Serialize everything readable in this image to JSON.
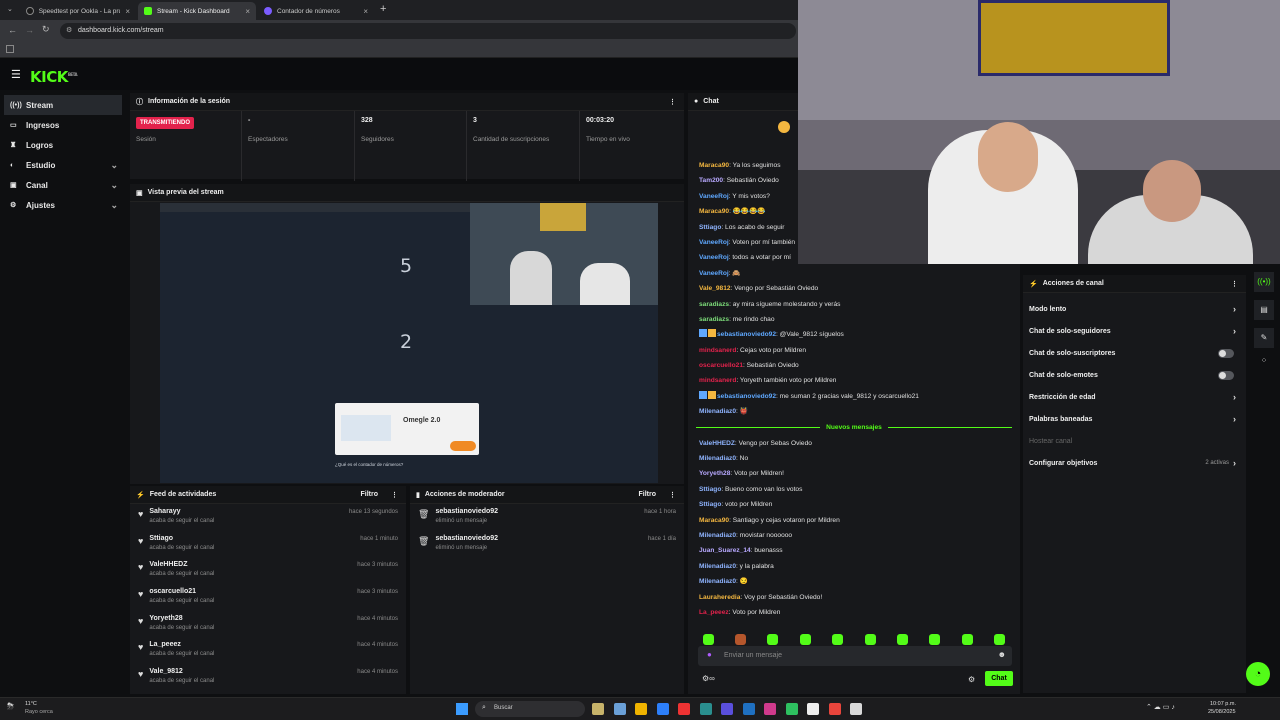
{
  "browser": {
    "tabs": [
      {
        "title": "Speedtest por Ookla - La prueba de velocidad",
        "active": false
      },
      {
        "title": "Stream - Kick Dashboard",
        "active": true
      },
      {
        "title": "Contador de números",
        "active": false
      }
    ],
    "url": "dashboard.kick.com/stream"
  },
  "kick": {
    "logo": "KICK",
    "beta": "BETA"
  },
  "sidebar": {
    "items": [
      {
        "label": "Stream",
        "icon": "stream-icon",
        "selected": true,
        "expand": false
      },
      {
        "label": "Ingresos",
        "icon": "wallet-icon",
        "selected": false,
        "expand": false
      },
      {
        "label": "Logros",
        "icon": "trophy-icon",
        "selected": false,
        "expand": false
      },
      {
        "label": "Estudio",
        "icon": "studio-icon",
        "selected": false,
        "expand": true
      },
      {
        "label": "Canal",
        "icon": "channel-icon",
        "selected": false,
        "expand": true
      },
      {
        "label": "Ajustes",
        "icon": "gear-icon",
        "selected": false,
        "expand": true
      }
    ]
  },
  "session": {
    "title": "Información de la sesión",
    "badge": "TRANSMITIENDO",
    "stats": [
      {
        "value": "",
        "label": "Sesión"
      },
      {
        "value": "-",
        "label": "Espectadores"
      },
      {
        "value": "328",
        "label": "Seguidores"
      },
      {
        "value": "3",
        "label": "Cantidad de suscripciones"
      },
      {
        "value": "00:03:20",
        "label": "Tiempo en vivo"
      }
    ]
  },
  "preview": {
    "title": "Vista previa del stream",
    "numbers": [
      "5",
      "2"
    ],
    "omegle": "Omegle 2.0",
    "question": "¿Qué es el contador de números?"
  },
  "feed": {
    "title": "Feed de actividades",
    "filter": "Filtro",
    "items": [
      {
        "name": "Saharayy",
        "action": "acaba de seguir el canal",
        "time": "hace 13 segundos"
      },
      {
        "name": "Sttiago",
        "action": "acaba de seguir el canal",
        "time": "hace 1 minuto"
      },
      {
        "name": "ValeHHEDZ",
        "action": "acaba de seguir el canal",
        "time": "hace 3 minutos"
      },
      {
        "name": "oscarcuello21",
        "action": "acaba de seguir el canal",
        "time": "hace 3 minutos"
      },
      {
        "name": "Yoryeth28",
        "action": "acaba de seguir el canal",
        "time": "hace 4 minutos"
      },
      {
        "name": "La_peeez",
        "action": "acaba de seguir el canal",
        "time": "hace 4 minutos"
      },
      {
        "name": "Vale_9812",
        "action": "acaba de seguir el canal",
        "time": "hace 4 minutos"
      }
    ]
  },
  "mod": {
    "title": "Acciones de moderador",
    "filter": "Filtro",
    "items": [
      {
        "name": "sebastianoviedo92",
        "action": "eliminó un mensaje",
        "time": "hace 1 hora"
      },
      {
        "name": "sebastianoviedo92",
        "action": "eliminó un mensaje",
        "time": "hace 1 día"
      }
    ]
  },
  "chat": {
    "title": "Chat",
    "divider": "Nuevos mensajes",
    "placeholder": "Enviar un mensaje",
    "send": "Chat",
    "messages": [
      {
        "user": "Maraca90",
        "color": "#f4b740",
        "text": ": Ya los seguimos",
        "badges": 0
      },
      {
        "user": "Tam200",
        "color": "#b8a9ff",
        "text": ": Sebastián Oviedo",
        "badges": 0
      },
      {
        "user": "VaneeRoj",
        "color": "#5fa8ff",
        "text": ": Y mis votos?",
        "badges": 0
      },
      {
        "user": "Maraca90",
        "color": "#f4b740",
        "text": ": 😂😂😂😂",
        "badges": 0
      },
      {
        "user": "Sttiago",
        "color": "#8fb4ff",
        "text": ": Los acabo de seguir",
        "badges": 0
      },
      {
        "user": "VaneeRoj",
        "color": "#5fa8ff",
        "text": ": Voten por mí también",
        "badges": 0
      },
      {
        "user": "VaneeRoj",
        "color": "#5fa8ff",
        "text": ": todos a votar por mí",
        "badges": 0
      },
      {
        "user": "VaneeRoj",
        "color": "#5fa8ff",
        "text": ": 🙈",
        "badges": 0
      },
      {
        "user": "Vale_9812",
        "color": "#f4b740",
        "text": ": Vengo por Sebastián Oviedo",
        "badges": 0
      },
      {
        "user": "saradiazs",
        "color": "#7ddc7a",
        "text": ": ay mira sígueme molestando y verás",
        "badges": 0
      },
      {
        "user": "saradiazs",
        "color": "#7ddc7a",
        "text": ": me rindo chao",
        "badges": 0
      },
      {
        "user": "sebastianoviedo92",
        "color": "#5fa8ff",
        "text": ": @Vale_9812 síguelos",
        "badges": 2
      },
      {
        "user": "mindsanerd",
        "color": "#e3224c",
        "text": ": Cejas voto por Mildren",
        "badges": 0
      },
      {
        "user": "oscarcuello21",
        "color": "#e3224c",
        "text": ": Sebastián Oviedo",
        "badges": 0
      },
      {
        "user": "mindsanerd",
        "color": "#e3224c",
        "text": ": Yoryeth también voto por Mildren",
        "badges": 0
      },
      {
        "user": "sebastianoviedo92",
        "color": "#5fa8ff",
        "text": ": me suman 2 gracias vale_9812 y oscarcuello21",
        "badges": 2
      },
      {
        "user": "Milenadiaz0",
        "color": "#8fb4ff",
        "text": ": 👹",
        "badges": 0
      }
    ],
    "new_messages": [
      {
        "user": "ValeHHEDZ",
        "color": "#8fb4ff",
        "text": ": Vengo por Sebas Oviedo"
      },
      {
        "user": "Milenadiaz0",
        "color": "#8fb4ff",
        "text": ": No"
      },
      {
        "user": "Yoryeth28",
        "color": "#b8a9ff",
        "text": ": Voto por Mildren!"
      },
      {
        "user": "Sttiago",
        "color": "#8fb4ff",
        "text": ": Bueno como van los votos"
      },
      {
        "user": "Sttiago",
        "color": "#8fb4ff",
        "text": ": voto por Mildren"
      },
      {
        "user": "Maraca90",
        "color": "#f4b740",
        "text": ": Santiago y cejas votaron por Mildren"
      },
      {
        "user": "Milenadiaz0",
        "color": "#8fb4ff",
        "text": ": movistar noooooo"
      },
      {
        "user": "Juan_Suarez_14",
        "color": "#b8a9ff",
        "text": ": buenasss"
      },
      {
        "user": "Milenadiaz0",
        "color": "#8fb4ff",
        "text": ": y la palabra"
      },
      {
        "user": "Milenadiaz0",
        "color": "#8fb4ff",
        "text": ": 😏"
      },
      {
        "user": "Lauraheredia",
        "color": "#f4b740",
        "text": ": Voy por Sebastián Oviedo!"
      },
      {
        "user": "La_peeez",
        "color": "#e3224c",
        "text": ": Voto por Mildren"
      }
    ]
  },
  "channel_actions": {
    "title": "Acciones de canal",
    "items": [
      {
        "label": "Modo lento",
        "control": "chevron"
      },
      {
        "label": "Chat de solo-seguidores",
        "control": "chevron"
      },
      {
        "label": "Chat de solo-suscriptores",
        "control": "toggle"
      },
      {
        "label": "Chat de solo-emotes",
        "control": "toggle"
      },
      {
        "label": "Restricción de edad",
        "control": "chevron"
      },
      {
        "label": "Palabras baneadas",
        "control": "chevron"
      },
      {
        "label": "Hostear canal",
        "control": "none"
      },
      {
        "label": "Configurar objetivos",
        "control": "chevron",
        "extra": "2 activas"
      }
    ]
  },
  "taskbar": {
    "weather_temp": "11°C",
    "weather_text": "Rayo cerca",
    "search": "Buscar",
    "time": "10:07 p.m.",
    "date": "25/08/2025"
  },
  "colors": {
    "accent": "#53fc18",
    "live": "#e3224c"
  }
}
